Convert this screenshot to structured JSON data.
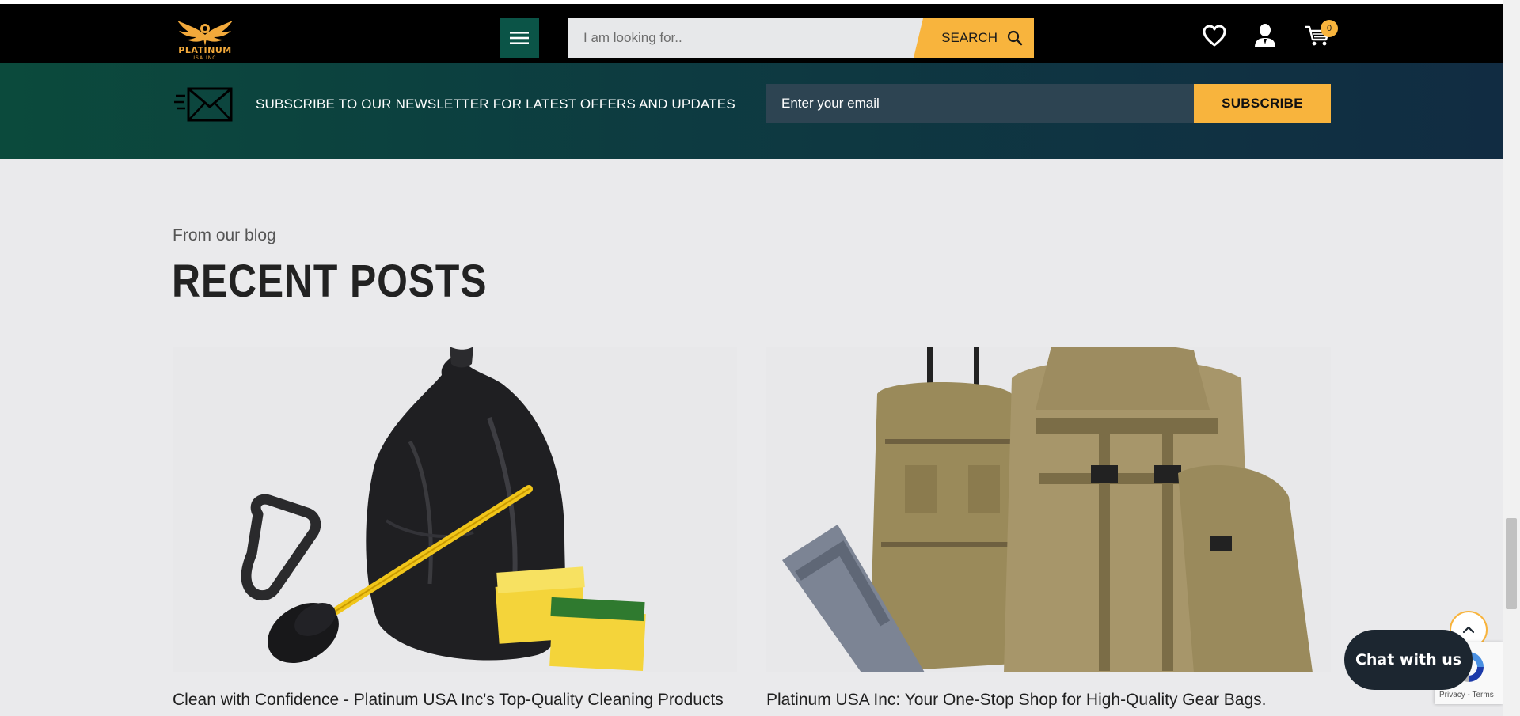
{
  "header": {
    "logo_text": "PLATINUM",
    "logo_subtext": "USA INC.",
    "search_placeholder": "I am looking for..",
    "search_button_label": "SEARCH",
    "cart_count": "0"
  },
  "newsletter": {
    "text": "SUBSCRIBE TO OUR NEWSLETTER FOR LATEST OFFERS AND UPDATES",
    "email_placeholder": "Enter your email",
    "button_label": "SUBSCRIBE"
  },
  "blog": {
    "kicker": "From our blog",
    "title": "RECENT POSTS",
    "posts": [
      {
        "title": "Clean with Confidence - Platinum USA Inc's Top-Quality Cleaning Products"
      },
      {
        "title": "Platinum USA Inc: Your One-Stop Shop for High-Quality Gear Bags."
      }
    ]
  },
  "widgets": {
    "chat_label": "Chat with us",
    "recaptcha_terms": "Privacy - Terms"
  },
  "colors": {
    "accent": "#f8b43d",
    "menu_button": "#0b5447",
    "chat": "#1c2630"
  },
  "icons": [
    "menu-icon",
    "search-icon",
    "heart-icon",
    "user-icon",
    "cart-icon",
    "envelope-icon",
    "chevron-up-icon",
    "recaptcha-icon"
  ]
}
